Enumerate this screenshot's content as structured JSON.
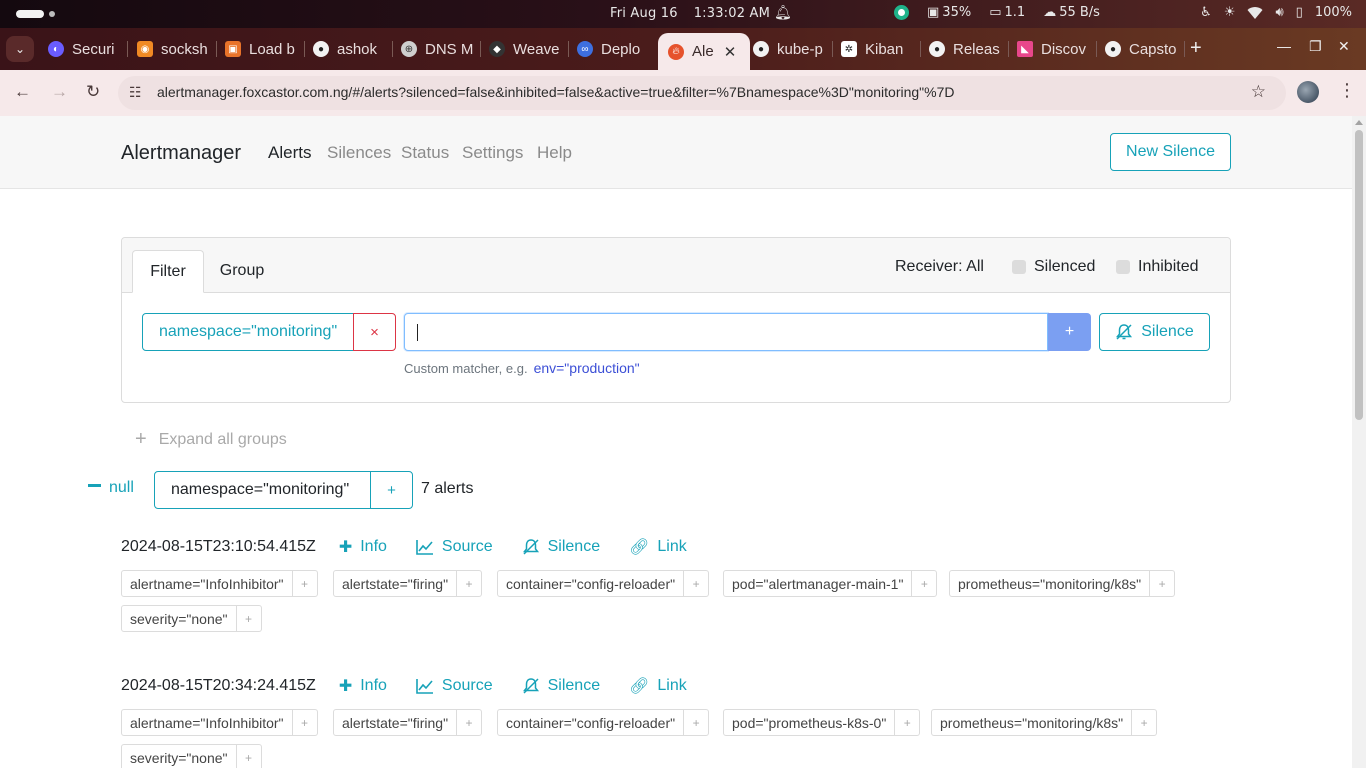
{
  "os": {
    "date": "Fri Aug 16",
    "time": "1:33:02 AM",
    "cpu": "35%",
    "display": "1.1",
    "network": "55 B/s",
    "battery": "100%"
  },
  "browser": {
    "tabs": [
      {
        "label": "Securi",
        "color": "#6a5cff"
      },
      {
        "label": "socksh",
        "color": "#f08a24"
      },
      {
        "label": "Load b",
        "color": "#e8732a"
      },
      {
        "label": "ashok",
        "color": "#f2f2f2"
      },
      {
        "label": "DNS M",
        "color": "#cfcfcf"
      },
      {
        "label": "Weave",
        "color": "#333333"
      },
      {
        "label": "Deplo",
        "color": "#3d6fe0"
      },
      {
        "label": "Ale",
        "color": "#e6522c"
      },
      {
        "label": "kube-p",
        "color": "#f2f2f2"
      },
      {
        "label": "Kiban",
        "color": "#ffffff"
      },
      {
        "label": "Releas",
        "color": "#f2f2f2"
      },
      {
        "label": "Discov",
        "color": "#e8478b"
      },
      {
        "label": "Capsto",
        "color": "#f2f2f2"
      }
    ],
    "url": "alertmanager.foxcastor.com.ng/#/alerts?silenced=false&inhibited=false&active=true&filter=%7Bnamespace%3D\"monitoring\"%7D"
  },
  "app": {
    "brand": "Alertmanager",
    "nav": [
      "Alerts",
      "Silences",
      "Status",
      "Settings",
      "Help"
    ],
    "new_silence": "New Silence",
    "filter": {
      "tab_filter": "Filter",
      "tab_group": "Group",
      "receiver": "Receiver: All",
      "silenced": "Silenced",
      "inhibited": "Inhibited",
      "matcher": "namespace=\"monitoring\"",
      "remove": "×",
      "add": "+",
      "silence_button": "Silence",
      "hint": "Custom matcher, e.g.",
      "hint_example": "env=\"production\""
    },
    "expand_all": "Expand all groups",
    "group": {
      "name": "null",
      "label": "namespace=\"monitoring\"",
      "add": "+",
      "count": "7 alerts"
    },
    "link_labels": {
      "info": "Info",
      "source": "Source",
      "silence": "Silence",
      "link": "Link"
    },
    "alerts": [
      {
        "time": "2024-08-15T23:10:54.415Z",
        "labels": [
          "alertname=\"InfoInhibitor\"",
          "alertstate=\"firing\"",
          "container=\"config-reloader\"",
          "pod=\"alertmanager-main-1\"",
          "prometheus=\"monitoring/k8s\"",
          "severity=\"none\""
        ]
      },
      {
        "time": "2024-08-15T20:34:24.415Z",
        "labels": [
          "alertname=\"InfoInhibitor\"",
          "alertstate=\"firing\"",
          "container=\"config-reloader\"",
          "pod=\"prometheus-k8s-0\"",
          "prometheus=\"monitoring/k8s\"",
          "severity=\"none\""
        ]
      }
    ]
  },
  "colors": {
    "accent": "#17a2b8",
    "danger": "#dc3545",
    "add_button": "#7b9ff2"
  }
}
